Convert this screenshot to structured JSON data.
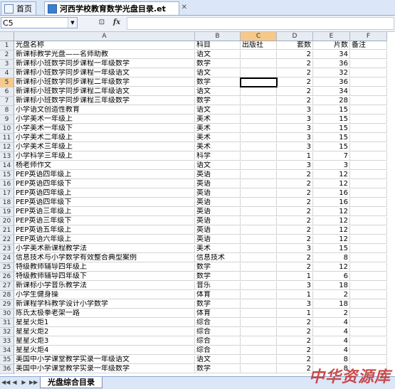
{
  "tabs": {
    "home_label": "首页",
    "doc_label": "河西学校教育数学光盘目录.et"
  },
  "formula_bar": {
    "name_box": "C5",
    "fx": "fx",
    "formula_value": ""
  },
  "columns": [
    "A",
    "B",
    "C",
    "D",
    "E",
    "F"
  ],
  "selected_cell": "C5",
  "rows": [
    {
      "n": "1",
      "a": "光盘名称",
      "b": "科目",
      "c": "出版社",
      "d": "套数",
      "e": "片数",
      "f": "备注"
    },
    {
      "n": "2",
      "a": "新课标教学光盘——名师助教",
      "b": "语文",
      "c": "",
      "d": "2",
      "e": "34",
      "f": ""
    },
    {
      "n": "3",
      "a": "新课标小班数学同步课程一年级数学",
      "b": "数学",
      "c": "",
      "d": "2",
      "e": "36",
      "f": ""
    },
    {
      "n": "4",
      "a": "新课标小班数学同步课程一年级语文",
      "b": "语文",
      "c": "",
      "d": "2",
      "e": "32",
      "f": ""
    },
    {
      "n": "5",
      "a": "新课标小班数学同步课程二年级数学",
      "b": "数学",
      "c": "",
      "d": "2",
      "e": "36",
      "f": ""
    },
    {
      "n": "6",
      "a": "新课标小班数学同步课程二年级语文",
      "b": "语文",
      "c": "",
      "d": "2",
      "e": "34",
      "f": ""
    },
    {
      "n": "7",
      "a": "新课标小班数学同步课程三年级数学",
      "b": "数学",
      "c": "",
      "d": "2",
      "e": "28",
      "f": ""
    },
    {
      "n": "8",
      "a": "小学语文创造性教育",
      "b": "语文",
      "c": "",
      "d": "3",
      "e": "15",
      "f": ""
    },
    {
      "n": "9",
      "a": "小学美术一年级上",
      "b": "美术",
      "c": "",
      "d": "3",
      "e": "15",
      "f": ""
    },
    {
      "n": "10",
      "a": "小学美术一年级下",
      "b": "美术",
      "c": "",
      "d": "3",
      "e": "15",
      "f": ""
    },
    {
      "n": "11",
      "a": "小学美术二年级上",
      "b": "美术",
      "c": "",
      "d": "3",
      "e": "15",
      "f": ""
    },
    {
      "n": "12",
      "a": "小学美术三年级上",
      "b": "美术",
      "c": "",
      "d": "3",
      "e": "15",
      "f": ""
    },
    {
      "n": "13",
      "a": "小学科学三年级上",
      "b": "科学",
      "c": "",
      "d": "1",
      "e": "7",
      "f": ""
    },
    {
      "n": "14",
      "a": "杨老师作文",
      "b": "语文",
      "c": "",
      "d": "3",
      "e": "3",
      "f": ""
    },
    {
      "n": "15",
      "a": "PEP英语四年级上",
      "b": "英语",
      "c": "",
      "d": "2",
      "e": "12",
      "f": ""
    },
    {
      "n": "16",
      "a": "PEP英语四年级下",
      "b": "英语",
      "c": "",
      "d": "2",
      "e": "12",
      "f": ""
    },
    {
      "n": "17",
      "a": "PEP英语四年级上",
      "b": "英语",
      "c": "",
      "d": "2",
      "e": "16",
      "f": ""
    },
    {
      "n": "18",
      "a": "PEP英语四年级下",
      "b": "英语",
      "c": "",
      "d": "2",
      "e": "16",
      "f": ""
    },
    {
      "n": "19",
      "a": "PEP英语三年级上",
      "b": "英语",
      "c": "",
      "d": "2",
      "e": "12",
      "f": ""
    },
    {
      "n": "20",
      "a": "PEP英语三年级下",
      "b": "英语",
      "c": "",
      "d": "2",
      "e": "12",
      "f": ""
    },
    {
      "n": "21",
      "a": "PEP英语五年级上",
      "b": "英语",
      "c": "",
      "d": "2",
      "e": "12",
      "f": ""
    },
    {
      "n": "22",
      "a": "PEP英语六年级上",
      "b": "英语",
      "c": "",
      "d": "2",
      "e": "12",
      "f": ""
    },
    {
      "n": "23",
      "a": "小学美术新课程教学法",
      "b": "美术",
      "c": "",
      "d": "3",
      "e": "15",
      "f": ""
    },
    {
      "n": "24",
      "a": "信息技术与小学数学有效整合典型案例",
      "b": "信息技术",
      "c": "",
      "d": "2",
      "e": "8",
      "f": ""
    },
    {
      "n": "25",
      "a": "特级教师辅导四年级上",
      "b": "数学",
      "c": "",
      "d": "2",
      "e": "12",
      "f": ""
    },
    {
      "n": "26",
      "a": "特级教师辅导四年级下",
      "b": "数学",
      "c": "",
      "d": "1",
      "e": "6",
      "f": ""
    },
    {
      "n": "27",
      "a": "新课标小学音乐教学法",
      "b": "音乐",
      "c": "",
      "d": "3",
      "e": "18",
      "f": ""
    },
    {
      "n": "28",
      "a": "小学生健身操",
      "b": "体育",
      "c": "",
      "d": "1",
      "e": "2",
      "f": ""
    },
    {
      "n": "29",
      "a": "新课程学科教学设计小学数学",
      "b": "数学",
      "c": "",
      "d": "3",
      "e": "18",
      "f": ""
    },
    {
      "n": "30",
      "a": "陈氏太极拳老架一路",
      "b": "体育",
      "c": "",
      "d": "1",
      "e": "2",
      "f": ""
    },
    {
      "n": "31",
      "a": "星星火炬1",
      "b": "综合",
      "c": "",
      "d": "2",
      "e": "4",
      "f": ""
    },
    {
      "n": "32",
      "a": "星星火炬2",
      "b": "综合",
      "c": "",
      "d": "2",
      "e": "4",
      "f": ""
    },
    {
      "n": "33",
      "a": "星星火炬3",
      "b": "综合",
      "c": "",
      "d": "2",
      "e": "4",
      "f": ""
    },
    {
      "n": "34",
      "a": "星星火炬4",
      "b": "综合",
      "c": "",
      "d": "2",
      "e": "4",
      "f": ""
    },
    {
      "n": "35",
      "a": "美国中小学课堂教学实录一年级语文",
      "b": "语文",
      "c": "",
      "d": "2",
      "e": "8",
      "f": ""
    },
    {
      "n": "36",
      "a": "美国中小学课堂教学实录一年级数学",
      "b": "数学",
      "c": "",
      "d": "2",
      "e": "8",
      "f": ""
    }
  ],
  "sheet_tab": "光盘综合目录",
  "watermark": "中华资源库"
}
